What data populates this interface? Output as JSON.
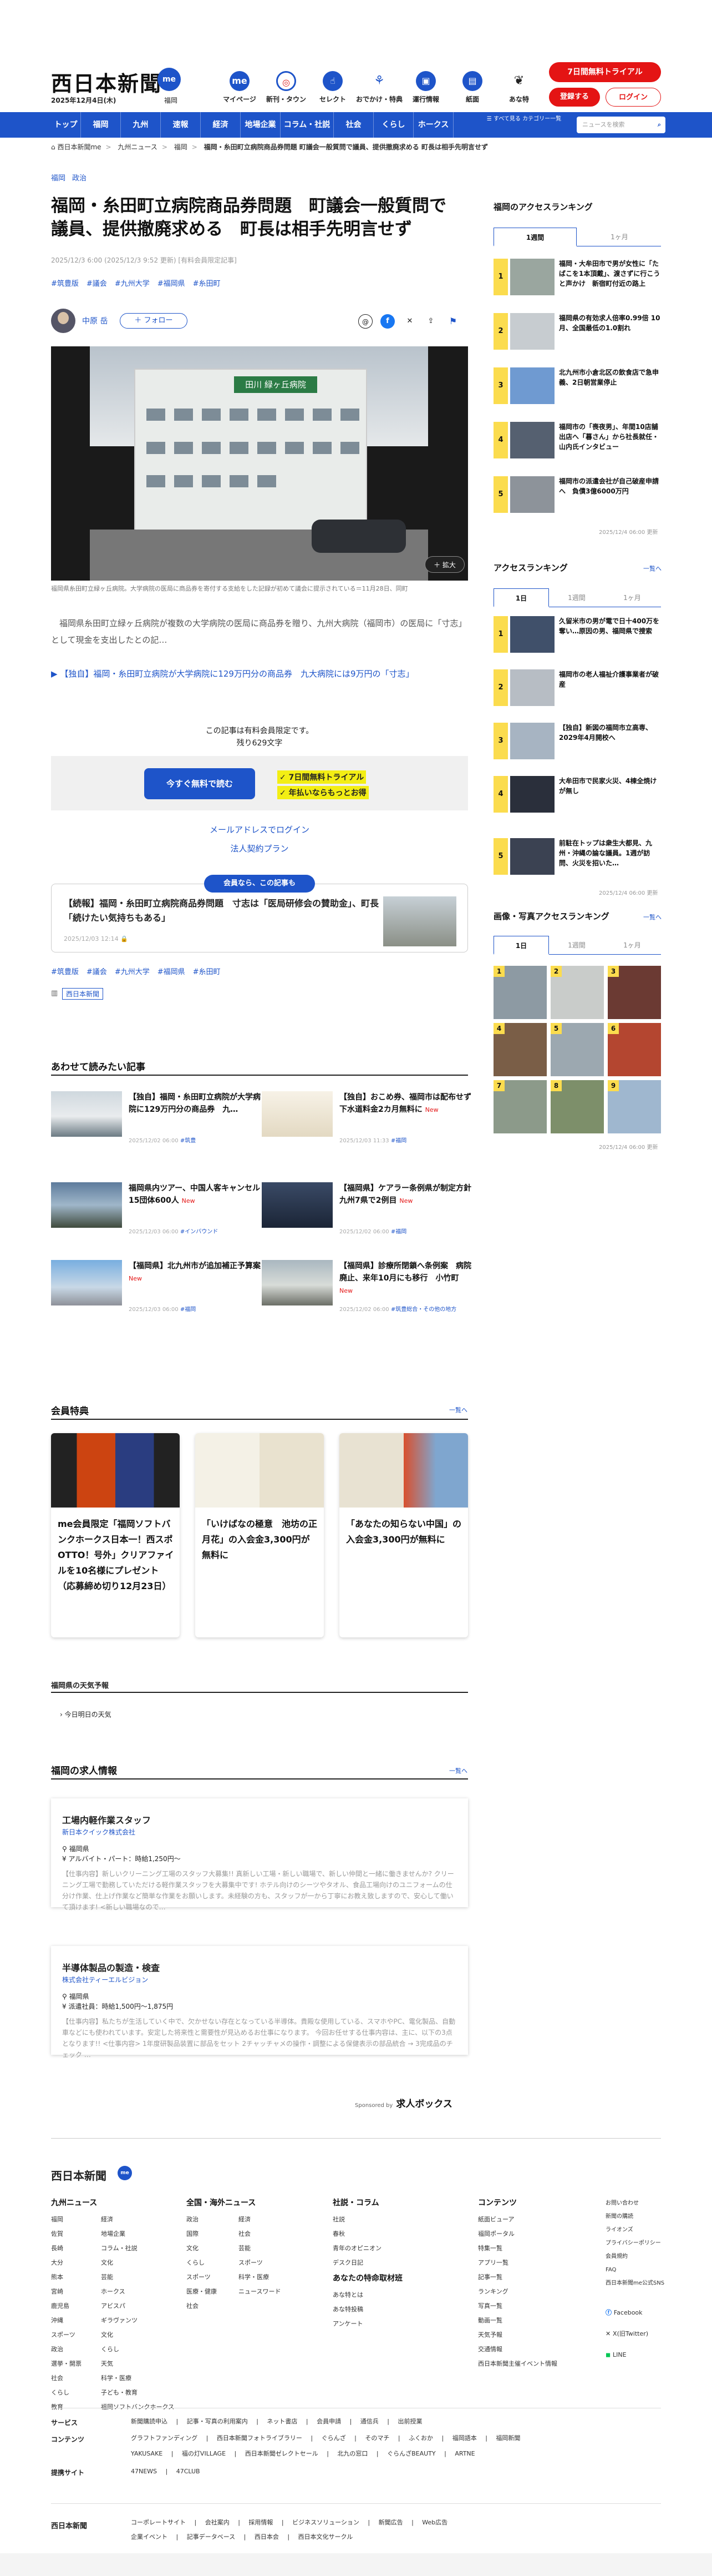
{
  "header": {
    "logo": "西日本新聞",
    "logo_me": "me",
    "date": "2025年12月4日(木)",
    "location": "福岡",
    "nav_icons": [
      {
        "label": "マイページ",
        "icon": "me"
      },
      {
        "label": "新刊・タウン",
        "icon": "target-icon"
      },
      {
        "label": "セレクト",
        "icon": "pointer-icon"
      },
      {
        "label": "おでかけ・特典",
        "icon": "walk-icon"
      },
      {
        "label": "運行情報",
        "icon": "train-icon"
      },
      {
        "label": "紙面",
        "icon": "newspaper-icon"
      },
      {
        "label": "あな特",
        "icon": "owl-icon"
      }
    ],
    "trial_button": "7日間無料トライアル",
    "register_button": "登録する",
    "login_button": "ログイン"
  },
  "global_nav": {
    "items": [
      "トップ",
      "福岡",
      "九州",
      "速報",
      "経済",
      "地場企業",
      "コラム・社説",
      "社会",
      "くらし",
      "ホークス"
    ],
    "all_menu": "すべて見る\nカテゴリー一覧",
    "search_placeholder": "ニュースを検索"
  },
  "breadcrumb": [
    "西日本新聞me",
    "九州ニュース",
    "福岡",
    "福岡・糸田町立病院商品券問題 町議会一般質問で議員、提供撤廃求める 町長は相手先明言せず"
  ],
  "article": {
    "categories": [
      "福岡",
      "政治"
    ],
    "title": "福岡・糸田町立病院商品券問題　町議会一般質問で議員、提供撤廃求める　町長は相手先明言せず",
    "meta": "2025/12/3 6:00 (2025/12/3 9:52 更新) [有料会員限定記事]",
    "tags": [
      "#筑豊版",
      "#議会",
      "#九州大学",
      "#福岡県",
      "#糸田町"
    ],
    "author": "中原 岳",
    "follow_label": "＋ フォロー",
    "share_icons": [
      "threads-icon",
      "facebook-icon",
      "x-icon",
      "share-icon",
      "bookmark-icon"
    ],
    "photo_sign": "田川 緑ヶ丘病院",
    "zoom_label": "＋ 拡大",
    "caption": "福岡県糸田町立緑ヶ丘病院。大学病院の医局に商品券を寄付する支給をした記録が初めて議会に提示されている＝11月28日、同町",
    "lead": "福岡県糸田町立緑ヶ丘病院が複数の大学病院の医局に商品券を贈り、九州大病院（福岡市）の医局に「寸志」として現金を支出したとの記…",
    "related_prefix": "▶",
    "related_text": "【独自】福岡・糸田町立病院が大学病院に129万円分の商品券　九大病院には9万円の「寸志」",
    "paywall_note": "この記事は有料会員限定です。",
    "remaining": "残り629文字",
    "paywall_button": "今すぐ無料で読む",
    "paywall_b1": "✓ 7日間無料トライアル",
    "paywall_b2": "✓ 年払いならもっとお得",
    "mail_login": "メールアドレスでログイン",
    "corp_plan": "法人契約プラン",
    "member_badge": "会員なら、この記事も",
    "member_card_title": "【続報】福岡・糸田町立病院商品券問題　寸志は「医局研修会の賛助金」、町長「続けたい気持ちもある」",
    "member_card_date": "2025/12/03 12:14 🔒",
    "tags2": [
      "#筑豊版",
      "#議会",
      "#九州大学",
      "#福岡県",
      "#糸田町"
    ],
    "publisher_badge": "西日本新聞"
  },
  "read_together": {
    "heading": "あわせて読みたい記事",
    "items": [
      {
        "title": "【独自】福岡・糸田町立病院が大学病院に129万円分の商品券　九…",
        "date": "2025/12/02 06:00",
        "tag": "#筑豊"
      },
      {
        "title": "【独自】おこめ券、福岡市は配布せず　下水道料金2カ月無料に",
        "new": "New",
        "date": "2025/12/03 11:33",
        "tag": "#福岡"
      },
      {
        "title": "福岡県内ツアー、中国人客キャンセル15団体600人",
        "new": "New",
        "date": "2025/12/03 06:00",
        "tag": "#インバウンド"
      },
      {
        "title": "【福岡県】ケアラー条例県が制定方針　九州7県で2例目",
        "new": "New",
        "date": "2025/12/02 06:00",
        "tag": "#福岡"
      },
      {
        "title": "【福岡県】北九州市が追加補正予算案",
        "new": "New",
        "date": "2025/12/03 06:00",
        "tag": "#福岡"
      },
      {
        "title": "【福岡県】診療所閉鎖へ条例案　病院廃止、来年10月にも移行　小竹町",
        "new": "New",
        "date": "2025/12/02 06:00",
        "tag": "#筑豊総合・その他の地方"
      }
    ]
  },
  "perks": {
    "heading": "会員特典",
    "more": "一覧へ",
    "items": [
      "me会員限定「福岡ソフトバンクホークス日本一！西スポOTTO！号外」クリアファイルを10名様にプレゼント（応募締め切り12月23日）",
      "「いけばなの極意　池坊の正月花」の入会金3,300円が無料に",
      "「あなたの知らない中国」の入会金3,300円が無料に"
    ]
  },
  "weather": {
    "heading": "福岡県の天気予報",
    "item": "今日明日の天気"
  },
  "jobs": {
    "heading": "福岡の求人情報",
    "more": "一覧へ",
    "items": [
      {
        "title": "工場内軽作業スタッフ",
        "company": "新日本クイック株式会社",
        "location": "福岡県",
        "salary": "アルバイト・パート：時給1,250円～",
        "desc": "【仕事内容】新しいクリーニング工場のスタッフ大募集!! 真新しい工場・新しい職場で、新しい仲間と一緒に働きませんか? クリーニング工場で勤務していただける軽作業スタッフを大募集中です! ホテル向けのシーツやタオル、食品工場向けのユニフォームの仕分け作業、仕上げ作業など簡単な作業をお願いします。未経験の方も、スタッフが一から丁寧にお教え致しますので、安心して働いて頂けます! <新しい職場なので…"
      },
      {
        "title": "半導体製品の製造・検査",
        "company": "株式会社ティーエルビジョン",
        "location": "福岡県",
        "salary": "派遣社員：時給1,500円～1,875円",
        "desc": "【仕事内容】私たちが生活していく中で、欠かせない存在となっている半導体。貴殿な使用している、スマホやPC、電化製品、自動車などにも使われています。安定した将来性と需要性が見込めるお仕事になります。 今回お任せする仕事内容は、主に、以下の3点となります!! <仕事内容> 1年度研製品装置に部品をセット 2チャッチャメの操作・調整による保健表示の部品統合 → 3完成品のチェック …"
      }
    ],
    "powered": "Sponsored by",
    "powered_brand": "求人ボックス"
  },
  "sidebar": {
    "access_ranking_heading": "福岡のアクセスランキング",
    "tabs1": [
      "1週間",
      "1ヶ月"
    ],
    "ranking1": [
      "福岡・大牟田市で男が女性に「たばこを1本頂戴」、渡さずに行こうと声かけ　新宿町付近の路上",
      "福岡県の有効求人倍率0.99倍 10月、全国最低の1.0割れ",
      "北九州市小倉北区の飲食店で急申義、2日朝営業停止",
      "福岡市の「喪夜男」、年間10店舗出店へ「暮さん」から社長就任・山内氏インタビュー",
      "福岡市の派遣会社が自己破産申請へ　負債3億6000万円"
    ],
    "updated1": "2025/12/4 06:00 更新",
    "access_heading": "アクセスランキング",
    "access_more": "一覧へ",
    "tabs2": [
      "1日",
      "1週間",
      "1ヶ月"
    ],
    "ranking2": [
      "久留米市の男が電で日十400万を奪い…原因の男、福岡県で捜索",
      "福岡市の老人福祉介護事業者が破産",
      "【独自】新図の福岡市立高専、2029年4月開校へ",
      "大牟田市で民家火災、4棟全焼けが無し",
      "前駐在トップは衆生大都見、九州・沖縄の論な議員。1週が訪問、火災を招いた…"
    ],
    "updated2": "2025/12/4 06:00 更新",
    "photo_heading": "画像・写真アクセスランキング",
    "photo_more": "一覧へ",
    "tabs3": [
      "1日",
      "1週間",
      "1ヶ月"
    ],
    "updated3": "2025/12/4 06:00 更新"
  },
  "footer": {
    "logo": "西日本新聞",
    "logo_me": "me",
    "col1_h": "九州ニュース",
    "col1": [
      "福岡",
      "佐賀",
      "長崎",
      "大分",
      "熊本",
      "宮崎",
      "鹿児島",
      "沖縄",
      "スポーツ",
      "政治",
      "選挙・開票",
      "社会",
      "くらし",
      "教育"
    ],
    "col1b": [
      "経済",
      "地場企業",
      "コラム・社説",
      "文化",
      "芸能",
      "ホークス",
      "アビスパ",
      "ギラヴァンツ",
      "文化",
      "くらし",
      "天気",
      "科学・医療",
      "子ども・教育",
      "福岡ソフトバンクホークス"
    ],
    "col2_h": "全国・海外ニュース",
    "col2": [
      "政治",
      "国際",
      "文化",
      "くらし",
      "スポーツ",
      "医療・健康",
      "社会"
    ],
    "col2b": [
      "経済",
      "社会",
      "芸能",
      "スポーツ",
      "科学・医療",
      "ニュースワード"
    ],
    "col3_h": "社説・コラム",
    "col3": [
      "社説",
      "春秋",
      "青年のオピニオン",
      "デスク日記"
    ],
    "col3_h2": "あなたの特命取材班",
    "col3b": [
      "あな特とは",
      "あな特投稿",
      "アンケート"
    ],
    "col4_h": "コンテンツ",
    "col4": [
      "紙面ビューア",
      "福岡ポータル",
      "特集一覧",
      "アプリ一覧",
      "記事一覧",
      "ランキング",
      "写真一覧",
      "動画一覧",
      "天気予報",
      "交通情報",
      "西日本新聞主催イベント情報"
    ],
    "col5": [
      "お問い合わせ",
      "新聞の購読",
      "ライオンズ",
      "プライバシーポリシー",
      "会員規約",
      "FAQ",
      "西日本新聞me公式SNS"
    ],
    "sns": [
      "Facebook",
      "X(旧Twitter)",
      "LINE"
    ],
    "rows": [
      {
        "h": "サービス",
        "v": "新聞購読申込 | 記事・写真の利用案内 | ネット書店 | 会員申請 | 通信兵 | 出前授業"
      },
      {
        "h": "コンテンツ",
        "v": "グラフトファンディング | 西日本新聞フォトライブラリー | ぐらんざ | そのマチ | ふくおか | 福岡語本 | 福岡新聞"
      },
      {
        "h": "",
        "v": "YAKUSAKE | 福の灯VILLAGE | 西日本新聞ゼレクトセール | 北九の窓口 | ぐらんざBEAUTY | ARTNE"
      },
      {
        "h": "提携サイト",
        "v": "47NEWS | 47CLUB"
      },
      {
        "h": "",
        "v": "コーポレートサイト | 会社案内 | 採用情報 | ビジネスソリューション | 新聞広告 | Web広告"
      },
      {
        "h": "",
        "v": "企業イベント | 記事データベース | 西日本会 | 西日本文化サークル"
      }
    ]
  }
}
